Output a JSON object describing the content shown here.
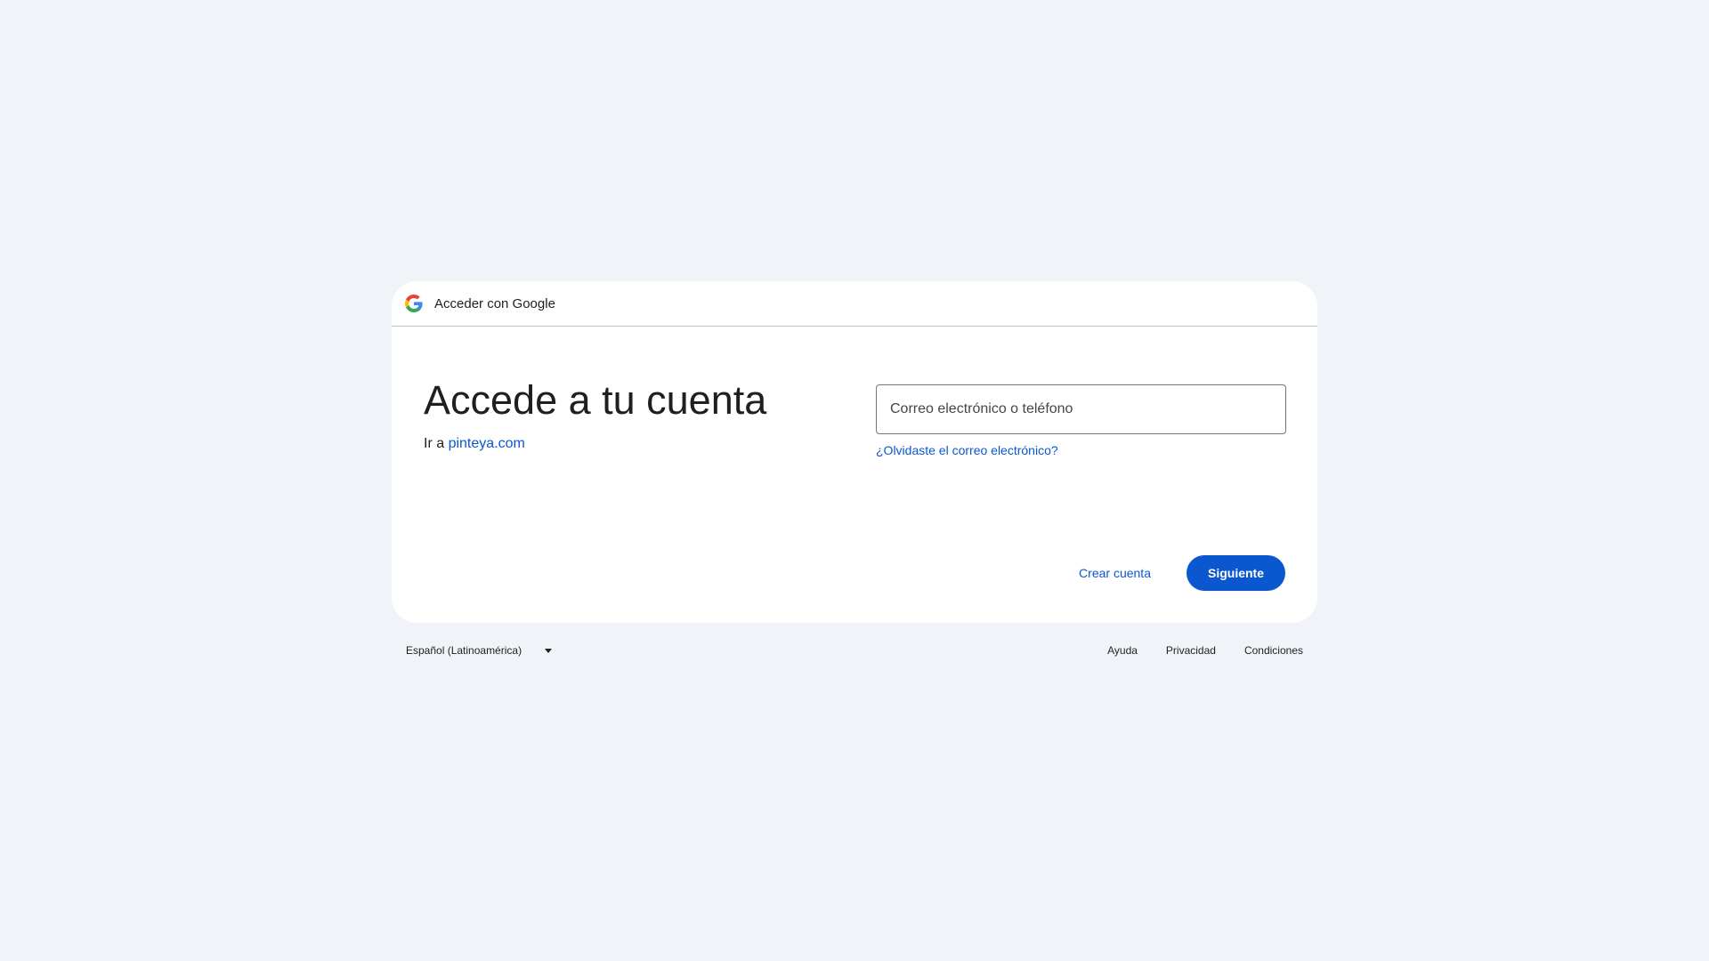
{
  "header": {
    "title": "Acceder con Google",
    "logo_icon": "google-g-icon"
  },
  "main": {
    "headline": "Accede a tu cuenta",
    "subline_prefix": "Ir a",
    "subline_link": "pinteya.com"
  },
  "form": {
    "email_placeholder": "Correo electrónico o teléfono",
    "email_value": "",
    "forgot_link": "¿Olvidaste el correo electrónico?"
  },
  "actions": {
    "create_account": "Crear cuenta",
    "next": "Siguiente"
  },
  "footer": {
    "language": "Español (Latinoamérica)",
    "links": [
      "Ayuda",
      "Privacidad",
      "Condiciones"
    ]
  },
  "colors": {
    "background": "#f0f4f9",
    "card": "#ffffff",
    "accent": "#0b57d0",
    "text": "#1f1f1f"
  }
}
